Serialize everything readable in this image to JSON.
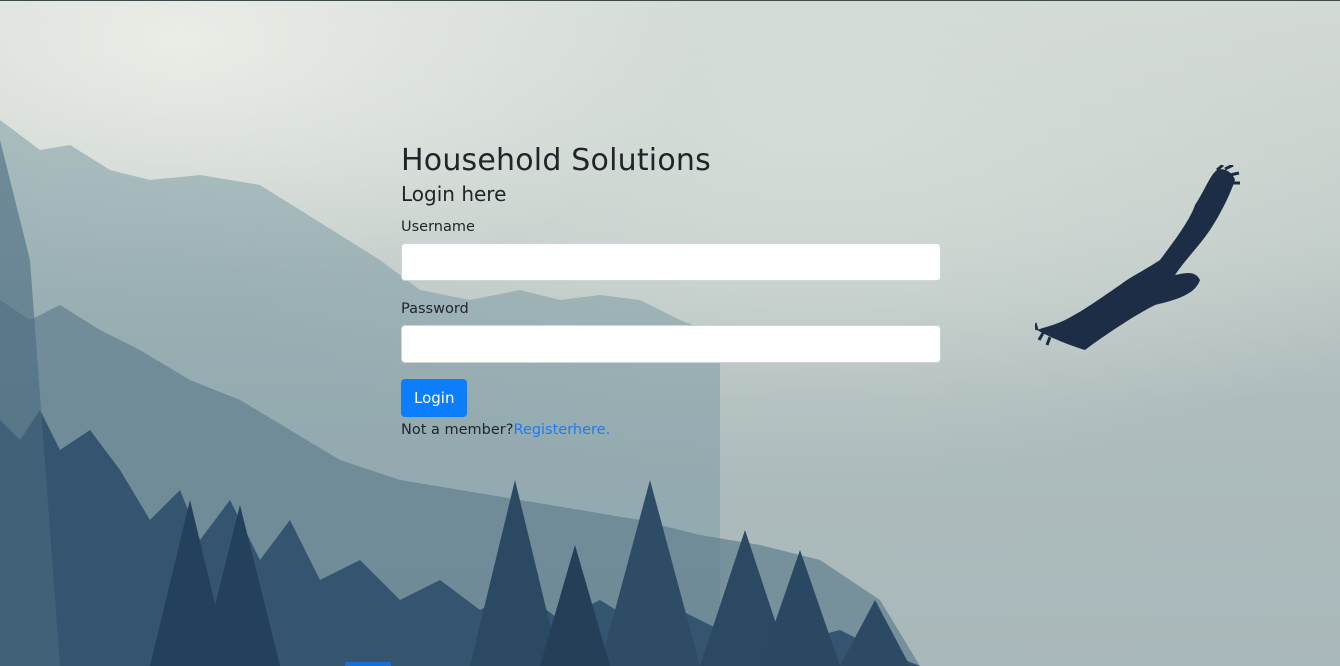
{
  "app": {
    "brand_title": "Household Solutions",
    "subtitle": "Login here"
  },
  "form": {
    "username_label": "Username",
    "username_value": "",
    "password_label": "Password",
    "password_value": "",
    "login_button_label": "Login",
    "register_prompt": "Not a member?",
    "register_link_text": "Registerhere."
  },
  "colors": {
    "accent": "#0d7efb",
    "link": "#1e7bf2",
    "text": "#212529"
  },
  "icons": [
    "eagle-illustration",
    "forest-background"
  ]
}
